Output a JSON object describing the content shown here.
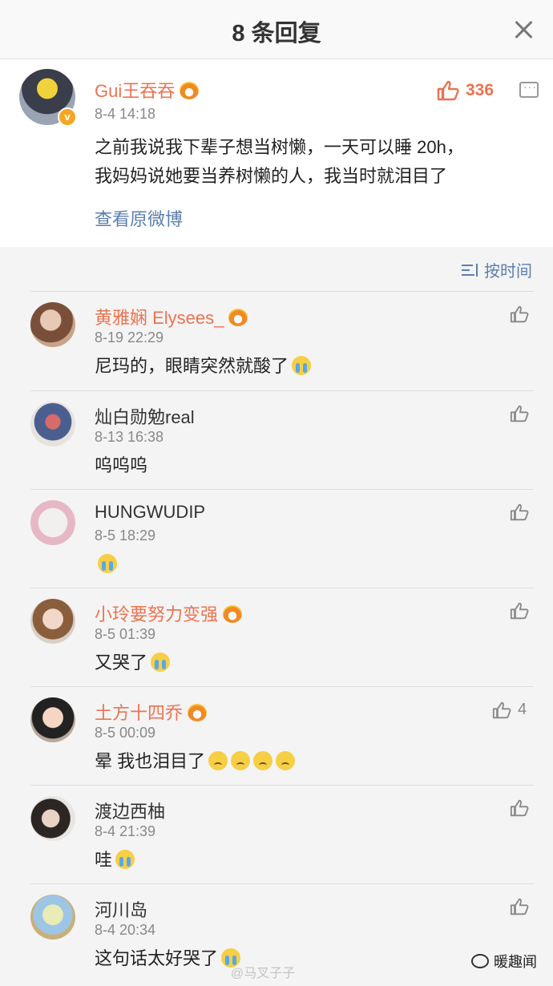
{
  "header": {
    "title": "8 条回复"
  },
  "main_post": {
    "username": "Gui王吞吞",
    "time": "8-4 14:18",
    "text_line1": "之前我说我下辈子想当树懒，一天可以睡 20h，",
    "text_line2": "我妈妈说她要当养树懒的人，我当时就泪目了",
    "link": "查看原微博",
    "like_count": "336",
    "verified_badge": "v"
  },
  "sort": {
    "label": "按时间"
  },
  "comments": [
    {
      "username": "黄雅娴 Elysees_",
      "vip": true,
      "time": "8-19 22:29",
      "text": "尼玛的，眼睛突然就酸了",
      "emojis": [
        "cry"
      ],
      "likes": ""
    },
    {
      "username": "灿白勋勉real",
      "vip": false,
      "time": "8-13 16:38",
      "text": "呜呜呜",
      "emojis": [],
      "likes": ""
    },
    {
      "username": "HUNGWUDIP",
      "vip": false,
      "time": "8-5 18:29",
      "text": "",
      "emojis": [
        "cry"
      ],
      "likes": ""
    },
    {
      "username": "小玲要努力变强",
      "vip": true,
      "time": "8-5 01:39",
      "text": "又哭了",
      "emojis": [
        "cry"
      ],
      "likes": ""
    },
    {
      "username": "土方十四乔",
      "vip": true,
      "time": "8-5 00:09",
      "text": "晕 我也泪目了",
      "emojis": [
        "sad",
        "sad",
        "sad",
        "sad"
      ],
      "likes": "4"
    },
    {
      "username": "渡边西柚",
      "vip": false,
      "time": "8-4 21:39",
      "text": "哇",
      "emojis": [
        "cry"
      ],
      "likes": ""
    },
    {
      "username": "河川岛",
      "vip": false,
      "time": "8-4 20:34",
      "text": "这句话太好哭了",
      "emojis": [
        "cry"
      ],
      "likes": ""
    }
  ],
  "footer": {
    "watermark": "@马叉子子",
    "brand": "暖趣闻"
  },
  "colors": {
    "accent": "#eb7350",
    "link": "#5b7fae",
    "background": "#f4f4f4"
  }
}
